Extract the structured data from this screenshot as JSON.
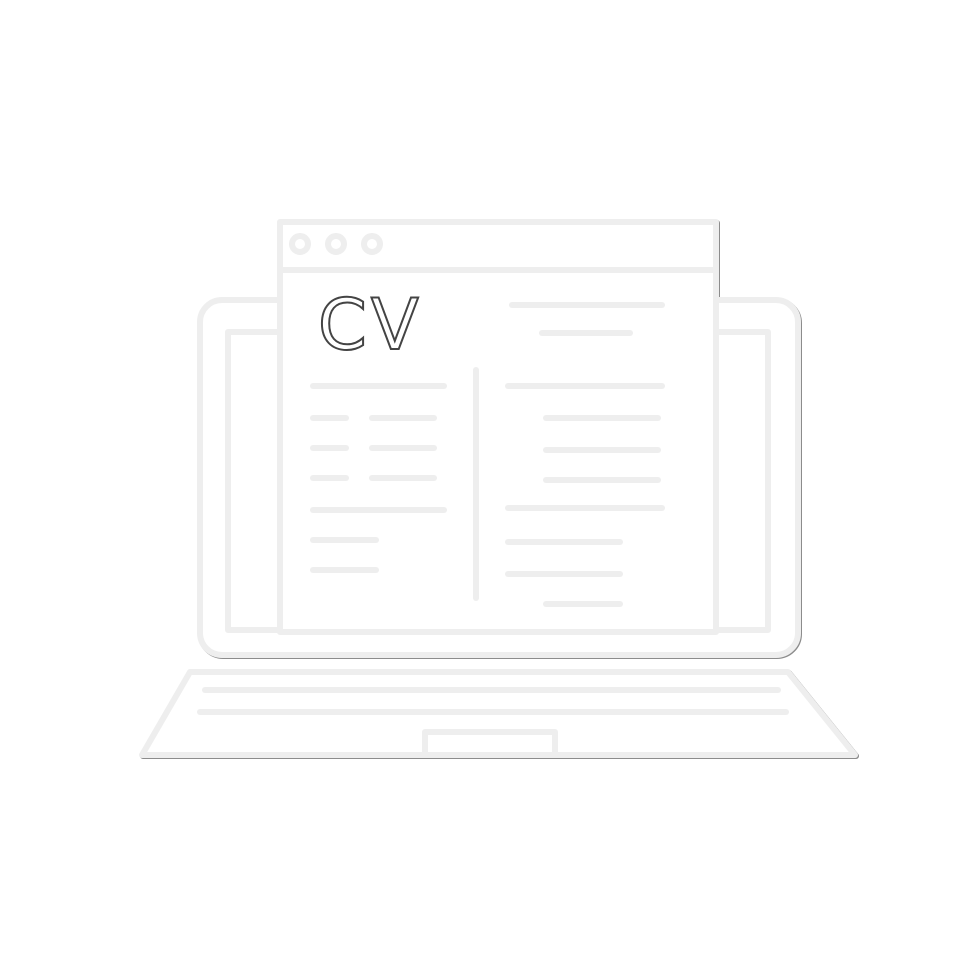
{
  "icon": {
    "name": "laptop-cv-icon",
    "cv_text": "CV",
    "stroke_color": "#eeeeee",
    "background_color": "#ffffff"
  }
}
